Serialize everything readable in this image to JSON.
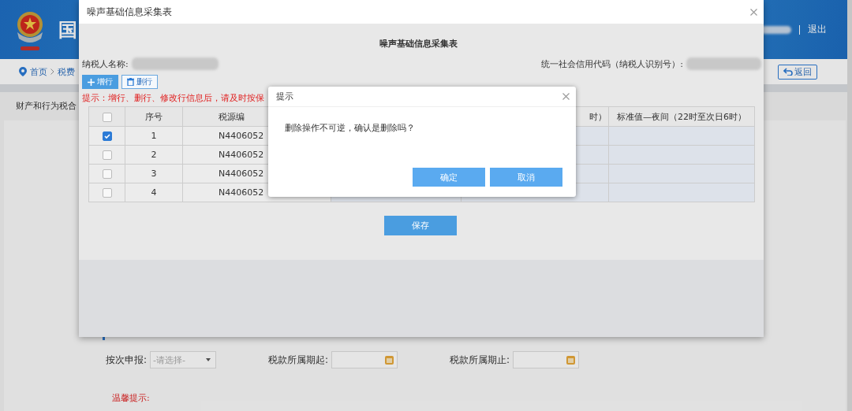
{
  "background_page": {
    "header": {
      "site_title": "国",
      "logout": "退出"
    },
    "breadcrumb": [
      {
        "label": "首页"
      },
      {
        "label": "税费"
      }
    ],
    "back_button": "返回",
    "tab": "财产和行为税合",
    "form": {
      "per_filing": {
        "label": "按次申报:",
        "placeholder": "-请选择-"
      },
      "period_start": {
        "label": "税款所属期起:"
      },
      "period_end": {
        "label": "税款所属期止:"
      }
    },
    "warm_tip": "温馨提示:"
  },
  "modal": {
    "title": "噪声基础信息采集表",
    "heading": "噪声基础信息采集表",
    "taxpayer_name_label": "纳税人名称:",
    "credit_code_label": "统一社会信用代码（纳税人识别号）:",
    "add_row_button": "增行",
    "delete_row_button": "删行",
    "notice": "提示：增行、删行、修改行信息后，请及时按保",
    "table": {
      "select_all_checked": false,
      "columns": {
        "number": "序号",
        "tax_source_id": "税源编",
        "column_5": "时）",
        "night_standard": "标准值—夜间（22时至次日6时）"
      },
      "rows": [
        {
          "checked": true,
          "number": "1",
          "tax_source_id": "N4406052"
        },
        {
          "checked": false,
          "number": "2",
          "tax_source_id": "N4406052"
        },
        {
          "checked": false,
          "number": "3",
          "tax_source_id": "N4406052"
        },
        {
          "checked": false,
          "number": "4",
          "tax_source_id": "N4406052"
        }
      ]
    },
    "save_button": "保存"
  },
  "confirm_dialog": {
    "title": "提示",
    "message": "删除操作不可逆，确认是删除吗？",
    "buttons": [
      "确定",
      "取消"
    ]
  }
}
